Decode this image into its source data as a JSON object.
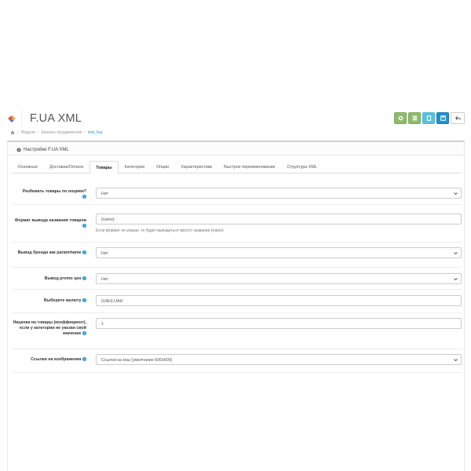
{
  "header": {
    "title": "F.UA XML",
    "toolbar": [
      "settings-icon",
      "list-icon",
      "copy-icon",
      "save-icon",
      "back-icon"
    ]
  },
  "breadcrumb": {
    "items": [
      "Модули",
      "Каналы продвижения",
      "test_fua"
    ]
  },
  "panel": {
    "heading": "Настройки F.UA XML"
  },
  "tabs": [
    {
      "label": "Основные"
    },
    {
      "label": "Доставка/Оплата"
    },
    {
      "label": "Товары"
    },
    {
      "label": "Категории"
    },
    {
      "label": "Опции"
    },
    {
      "label": "Характеристики"
    },
    {
      "label": "Быстрое переименование"
    },
    {
      "label": "Структура XML"
    }
  ],
  "form": {
    "split_by_options": {
      "label": "Разбивать товары по опциям?",
      "value": "Нет"
    },
    "name_format": {
      "label": "Формат вывода названия товаров",
      "value": "{name}",
      "hint": "Если формат не указан, то будет выводиться просто название {name}"
    },
    "brand_output": {
      "label": "Вывод бренда как param/name",
      "value": "Нет"
    },
    "promo_output": {
      "label": "Вывод promo цен",
      "value": "Нет"
    },
    "currency": {
      "label": "Выберите валюту",
      "value": "(UAH) UAH"
    },
    "markup": {
      "label": "Наценка на товары (коэффициент), если у категории не указан свой значение",
      "value": "1"
    },
    "image_links": {
      "label": "Ссылки на изображения",
      "value": "Ссылки на кеш (умолчание 600x600)"
    }
  }
}
